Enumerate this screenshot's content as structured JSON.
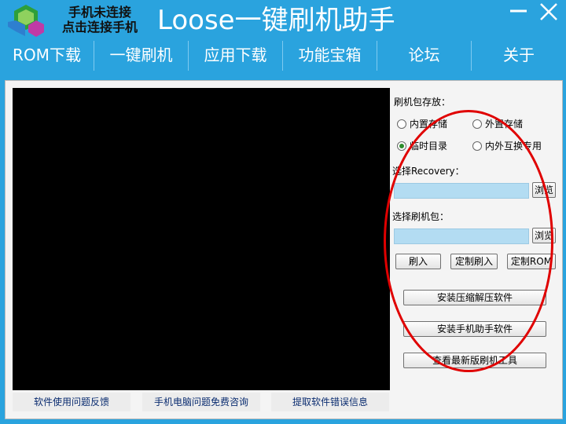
{
  "header": {
    "connection_line1": "手机未连接",
    "connection_line2": "点击连接手机",
    "app_title": "Loose一键刷机助手",
    "minimize_icon": "minimize-icon",
    "close_icon": "close-icon"
  },
  "nav": {
    "items": [
      "ROM下载",
      "一键刷机",
      "应用下载",
      "功能宝箱",
      "论坛",
      "关于"
    ]
  },
  "flash": {
    "storage_label": "刷机包存放：",
    "storage_options": [
      "内置存储",
      "外置存储",
      "临时目录",
      "内外互换专用"
    ],
    "storage_selected": "临时目录",
    "recovery_label": "选择Recovery：",
    "recovery_value": "",
    "package_label": "选择刷机包：",
    "package_value": "",
    "browse_label": "浏览",
    "flash_button": "刷入",
    "custom_flash_button": "定制刷入",
    "custom_rom_button": "定制ROM",
    "install_unzip_button": "安装压缩解压软件",
    "install_assistant_button": "安装手机助手软件",
    "latest_tool_button": "查看最新版刷机工具"
  },
  "footer": {
    "feedback": "软件使用问题反馈",
    "consult": "手机电脑问题免费咨询",
    "error_info": "提取软件错误信息"
  },
  "colors": {
    "titlebar": "#2aa3de",
    "screen": "#000000",
    "field": "#b3dcf2",
    "annotation": "#e00000"
  }
}
